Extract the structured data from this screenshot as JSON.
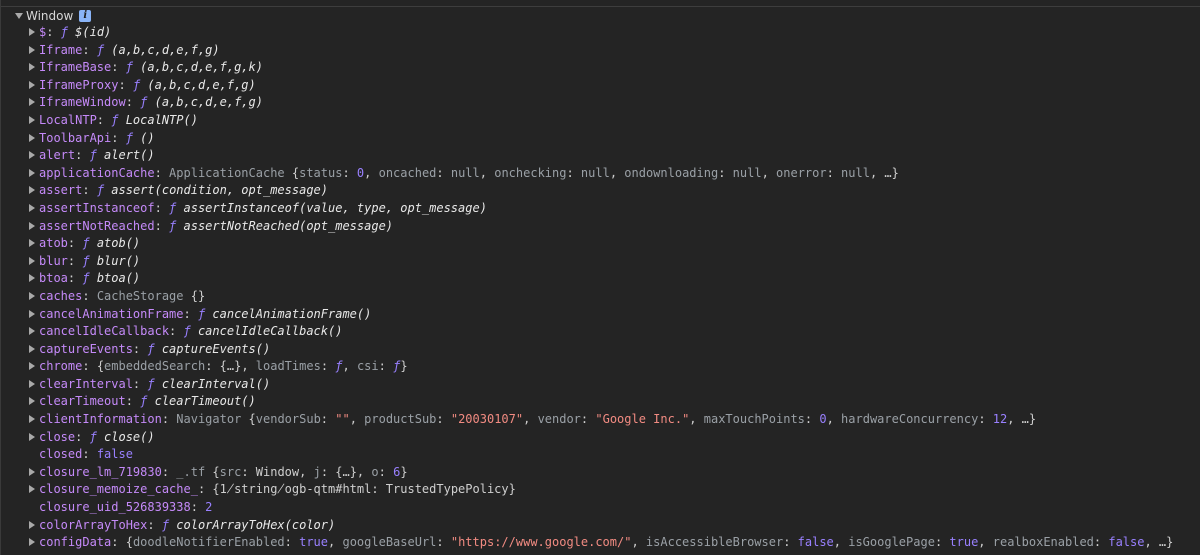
{
  "console": {
    "root_label": "Window",
    "info_badge": "i",
    "rows": [
      {
        "key": "$",
        "expandable": true,
        "parts": [
          [
            "f",
            "ƒ "
          ],
          [
            "fn",
            "$(id)"
          ]
        ]
      },
      {
        "key": "Iframe",
        "expandable": true,
        "parts": [
          [
            "f",
            "ƒ "
          ],
          [
            "fn",
            "(a,b,c,d,e,f,g)"
          ]
        ]
      },
      {
        "key": "IframeBase",
        "expandable": true,
        "parts": [
          [
            "f",
            "ƒ "
          ],
          [
            "fn",
            "(a,b,c,d,e,f,g,k)"
          ]
        ]
      },
      {
        "key": "IframeProxy",
        "expandable": true,
        "parts": [
          [
            "f",
            "ƒ "
          ],
          [
            "fn",
            "(a,b,c,d,e,f,g)"
          ]
        ]
      },
      {
        "key": "IframeWindow",
        "expandable": true,
        "parts": [
          [
            "f",
            "ƒ "
          ],
          [
            "fn",
            "(a,b,c,d,e,f,g)"
          ]
        ]
      },
      {
        "key": "LocalNTP",
        "expandable": true,
        "parts": [
          [
            "f",
            "ƒ "
          ],
          [
            "fn",
            "LocalNTP()"
          ]
        ]
      },
      {
        "key": "ToolbarApi",
        "expandable": true,
        "parts": [
          [
            "f",
            "ƒ "
          ],
          [
            "fn",
            "()"
          ]
        ]
      },
      {
        "key": "alert",
        "expandable": true,
        "parts": [
          [
            "f",
            "ƒ "
          ],
          [
            "fn",
            "alert()"
          ]
        ]
      },
      {
        "key": "applicationCache",
        "expandable": true,
        "parts": [
          [
            "cls",
            "ApplicationCache "
          ],
          [
            "val",
            "{"
          ],
          [
            "inner-key",
            "status"
          ],
          [
            "val",
            ": "
          ],
          [
            "num",
            "0"
          ],
          [
            "val",
            ", "
          ],
          [
            "inner-key",
            "oncached"
          ],
          [
            "val",
            ": "
          ],
          [
            "nul",
            "null"
          ],
          [
            "val",
            ", "
          ],
          [
            "inner-key",
            "onchecking"
          ],
          [
            "val",
            ": "
          ],
          [
            "nul",
            "null"
          ],
          [
            "val",
            ", "
          ],
          [
            "inner-key",
            "ondownloading"
          ],
          [
            "val",
            ": "
          ],
          [
            "nul",
            "null"
          ],
          [
            "val",
            ", "
          ],
          [
            "inner-key",
            "onerror"
          ],
          [
            "val",
            ": "
          ],
          [
            "nul",
            "null"
          ],
          [
            "val",
            ", …}"
          ]
        ]
      },
      {
        "key": "assert",
        "expandable": true,
        "parts": [
          [
            "f",
            "ƒ "
          ],
          [
            "fn",
            "assert(condition, opt_message)"
          ]
        ]
      },
      {
        "key": "assertInstanceof",
        "expandable": true,
        "parts": [
          [
            "f",
            "ƒ "
          ],
          [
            "fn",
            "assertInstanceof(value, type, opt_message)"
          ]
        ]
      },
      {
        "key": "assertNotReached",
        "expandable": true,
        "parts": [
          [
            "f",
            "ƒ "
          ],
          [
            "fn",
            "assertNotReached(opt_message)"
          ]
        ]
      },
      {
        "key": "atob",
        "expandable": true,
        "parts": [
          [
            "f",
            "ƒ "
          ],
          [
            "fn",
            "atob()"
          ]
        ]
      },
      {
        "key": "blur",
        "expandable": true,
        "parts": [
          [
            "f",
            "ƒ "
          ],
          [
            "fn",
            "blur()"
          ]
        ]
      },
      {
        "key": "btoa",
        "expandable": true,
        "parts": [
          [
            "f",
            "ƒ "
          ],
          [
            "fn",
            "btoa()"
          ]
        ]
      },
      {
        "key": "caches",
        "expandable": true,
        "parts": [
          [
            "cls",
            "CacheStorage "
          ],
          [
            "val",
            "{}"
          ]
        ]
      },
      {
        "key": "cancelAnimationFrame",
        "expandable": true,
        "parts": [
          [
            "f",
            "ƒ "
          ],
          [
            "fn",
            "cancelAnimationFrame()"
          ]
        ]
      },
      {
        "key": "cancelIdleCallback",
        "expandable": true,
        "parts": [
          [
            "f",
            "ƒ "
          ],
          [
            "fn",
            "cancelIdleCallback()"
          ]
        ]
      },
      {
        "key": "captureEvents",
        "expandable": true,
        "parts": [
          [
            "f",
            "ƒ "
          ],
          [
            "fn",
            "captureEvents()"
          ]
        ]
      },
      {
        "key": "chrome",
        "expandable": true,
        "parts": [
          [
            "val",
            "{"
          ],
          [
            "inner-key",
            "embeddedSearch"
          ],
          [
            "val",
            ": {…}, "
          ],
          [
            "inner-key",
            "loadTimes"
          ],
          [
            "val",
            ": "
          ],
          [
            "f",
            "ƒ"
          ],
          [
            "val",
            ", "
          ],
          [
            "inner-key",
            "csi"
          ],
          [
            "val",
            ": "
          ],
          [
            "f",
            "ƒ"
          ],
          [
            "val",
            "}"
          ]
        ]
      },
      {
        "key": "clearInterval",
        "expandable": true,
        "parts": [
          [
            "f",
            "ƒ "
          ],
          [
            "fn",
            "clearInterval()"
          ]
        ]
      },
      {
        "key": "clearTimeout",
        "expandable": true,
        "parts": [
          [
            "f",
            "ƒ "
          ],
          [
            "fn",
            "clearTimeout()"
          ]
        ]
      },
      {
        "key": "clientInformation",
        "expandable": true,
        "parts": [
          [
            "cls",
            "Navigator "
          ],
          [
            "val",
            "{"
          ],
          [
            "inner-key",
            "vendorSub"
          ],
          [
            "val",
            ": "
          ],
          [
            "str",
            "\"\""
          ],
          [
            "val",
            ", "
          ],
          [
            "inner-key",
            "productSub"
          ],
          [
            "val",
            ": "
          ],
          [
            "str",
            "\"20030107\""
          ],
          [
            "val",
            ", "
          ],
          [
            "inner-key",
            "vendor"
          ],
          [
            "val",
            ": "
          ],
          [
            "str",
            "\"Google Inc.\""
          ],
          [
            "val",
            ", "
          ],
          [
            "inner-key",
            "maxTouchPoints"
          ],
          [
            "val",
            ": "
          ],
          [
            "num",
            "0"
          ],
          [
            "val",
            ", "
          ],
          [
            "inner-key",
            "hardwareConcurrency"
          ],
          [
            "val",
            ": "
          ],
          [
            "num",
            "12"
          ],
          [
            "val",
            ", …}"
          ]
        ]
      },
      {
        "key": "close",
        "expandable": true,
        "parts": [
          [
            "f",
            "ƒ "
          ],
          [
            "fn",
            "close()"
          ]
        ]
      },
      {
        "key": "closed",
        "expandable": false,
        "parts": [
          [
            "lit",
            "false"
          ]
        ]
      },
      {
        "key": "closure_lm_719830",
        "expandable": true,
        "parts": [
          [
            "cls",
            "_.tf "
          ],
          [
            "val",
            "{"
          ],
          [
            "inner-key",
            "src"
          ],
          [
            "val",
            ": Window, "
          ],
          [
            "inner-key",
            "j"
          ],
          [
            "val",
            ": {…}, "
          ],
          [
            "inner-key",
            "o"
          ],
          [
            "val",
            ": "
          ],
          [
            "num",
            "6"
          ],
          [
            "val",
            "}"
          ]
        ]
      },
      {
        "key": "closure_memoize_cache_",
        "expandable": true,
        "parts": [
          [
            "val",
            "{1̸string̸ogb-qtm#html: TrustedTypePolicy}"
          ]
        ]
      },
      {
        "key": "closure_uid_526839338",
        "expandable": false,
        "parts": [
          [
            "num",
            "2"
          ]
        ]
      },
      {
        "key": "colorArrayToHex",
        "expandable": true,
        "parts": [
          [
            "f",
            "ƒ "
          ],
          [
            "fn",
            "colorArrayToHex(color)"
          ]
        ]
      },
      {
        "key": "configData",
        "expandable": true,
        "parts": [
          [
            "val",
            "{"
          ],
          [
            "inner-key",
            "doodleNotifierEnabled"
          ],
          [
            "val",
            ": "
          ],
          [
            "lit",
            "true"
          ],
          [
            "val",
            ", "
          ],
          [
            "inner-key",
            "googleBaseUrl"
          ],
          [
            "val",
            ": "
          ],
          [
            "str",
            "\"https://www.google.com/\""
          ],
          [
            "val",
            ", "
          ],
          [
            "inner-key",
            "isAccessibleBrowser"
          ],
          [
            "val",
            ": "
          ],
          [
            "lit",
            "false"
          ],
          [
            "val",
            ", "
          ],
          [
            "inner-key",
            "isGooglePage"
          ],
          [
            "val",
            ": "
          ],
          [
            "lit",
            "true"
          ],
          [
            "val",
            ", "
          ],
          [
            "inner-key",
            "realboxEnabled"
          ],
          [
            "val",
            ": "
          ],
          [
            "lit",
            "false"
          ],
          [
            "val",
            ", …}"
          ]
        ]
      }
    ]
  }
}
